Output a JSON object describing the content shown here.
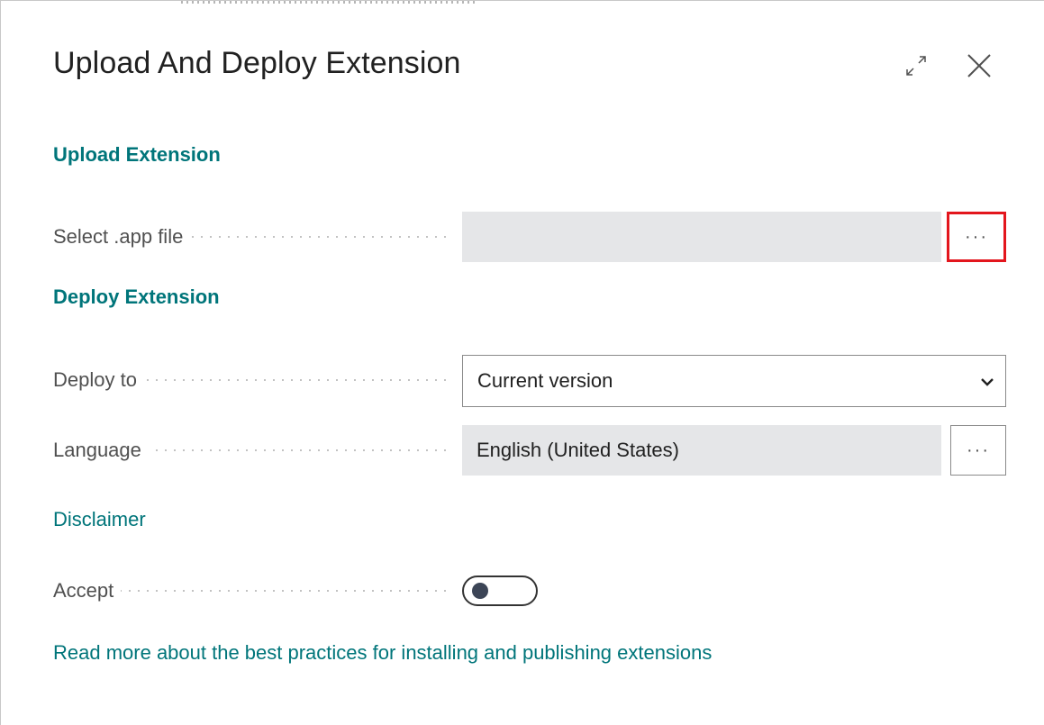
{
  "dialog": {
    "title": "Upload And Deploy Extension",
    "header_icons": [
      "expand-icon",
      "close-icon"
    ]
  },
  "sections": {
    "upload_header": "Upload Extension",
    "deploy_header": "Deploy Extension"
  },
  "fields": {
    "select_app_file": {
      "label": "Select .app file",
      "value": "",
      "lookup_label": "···"
    },
    "deploy_to": {
      "label": "Deploy to",
      "value": "Current version"
    },
    "language": {
      "label": "Language",
      "value": "English (United States)",
      "lookup_label": "···"
    },
    "accept": {
      "label": "Accept",
      "state": "off"
    }
  },
  "links": {
    "disclaimer": "Disclaimer",
    "best_practices": "Read more about the best practices for installing and publishing extensions"
  },
  "colors": {
    "accent_teal": "#00757a",
    "highlight_red": "#e3161d",
    "field_background": "#e5e6e8"
  }
}
